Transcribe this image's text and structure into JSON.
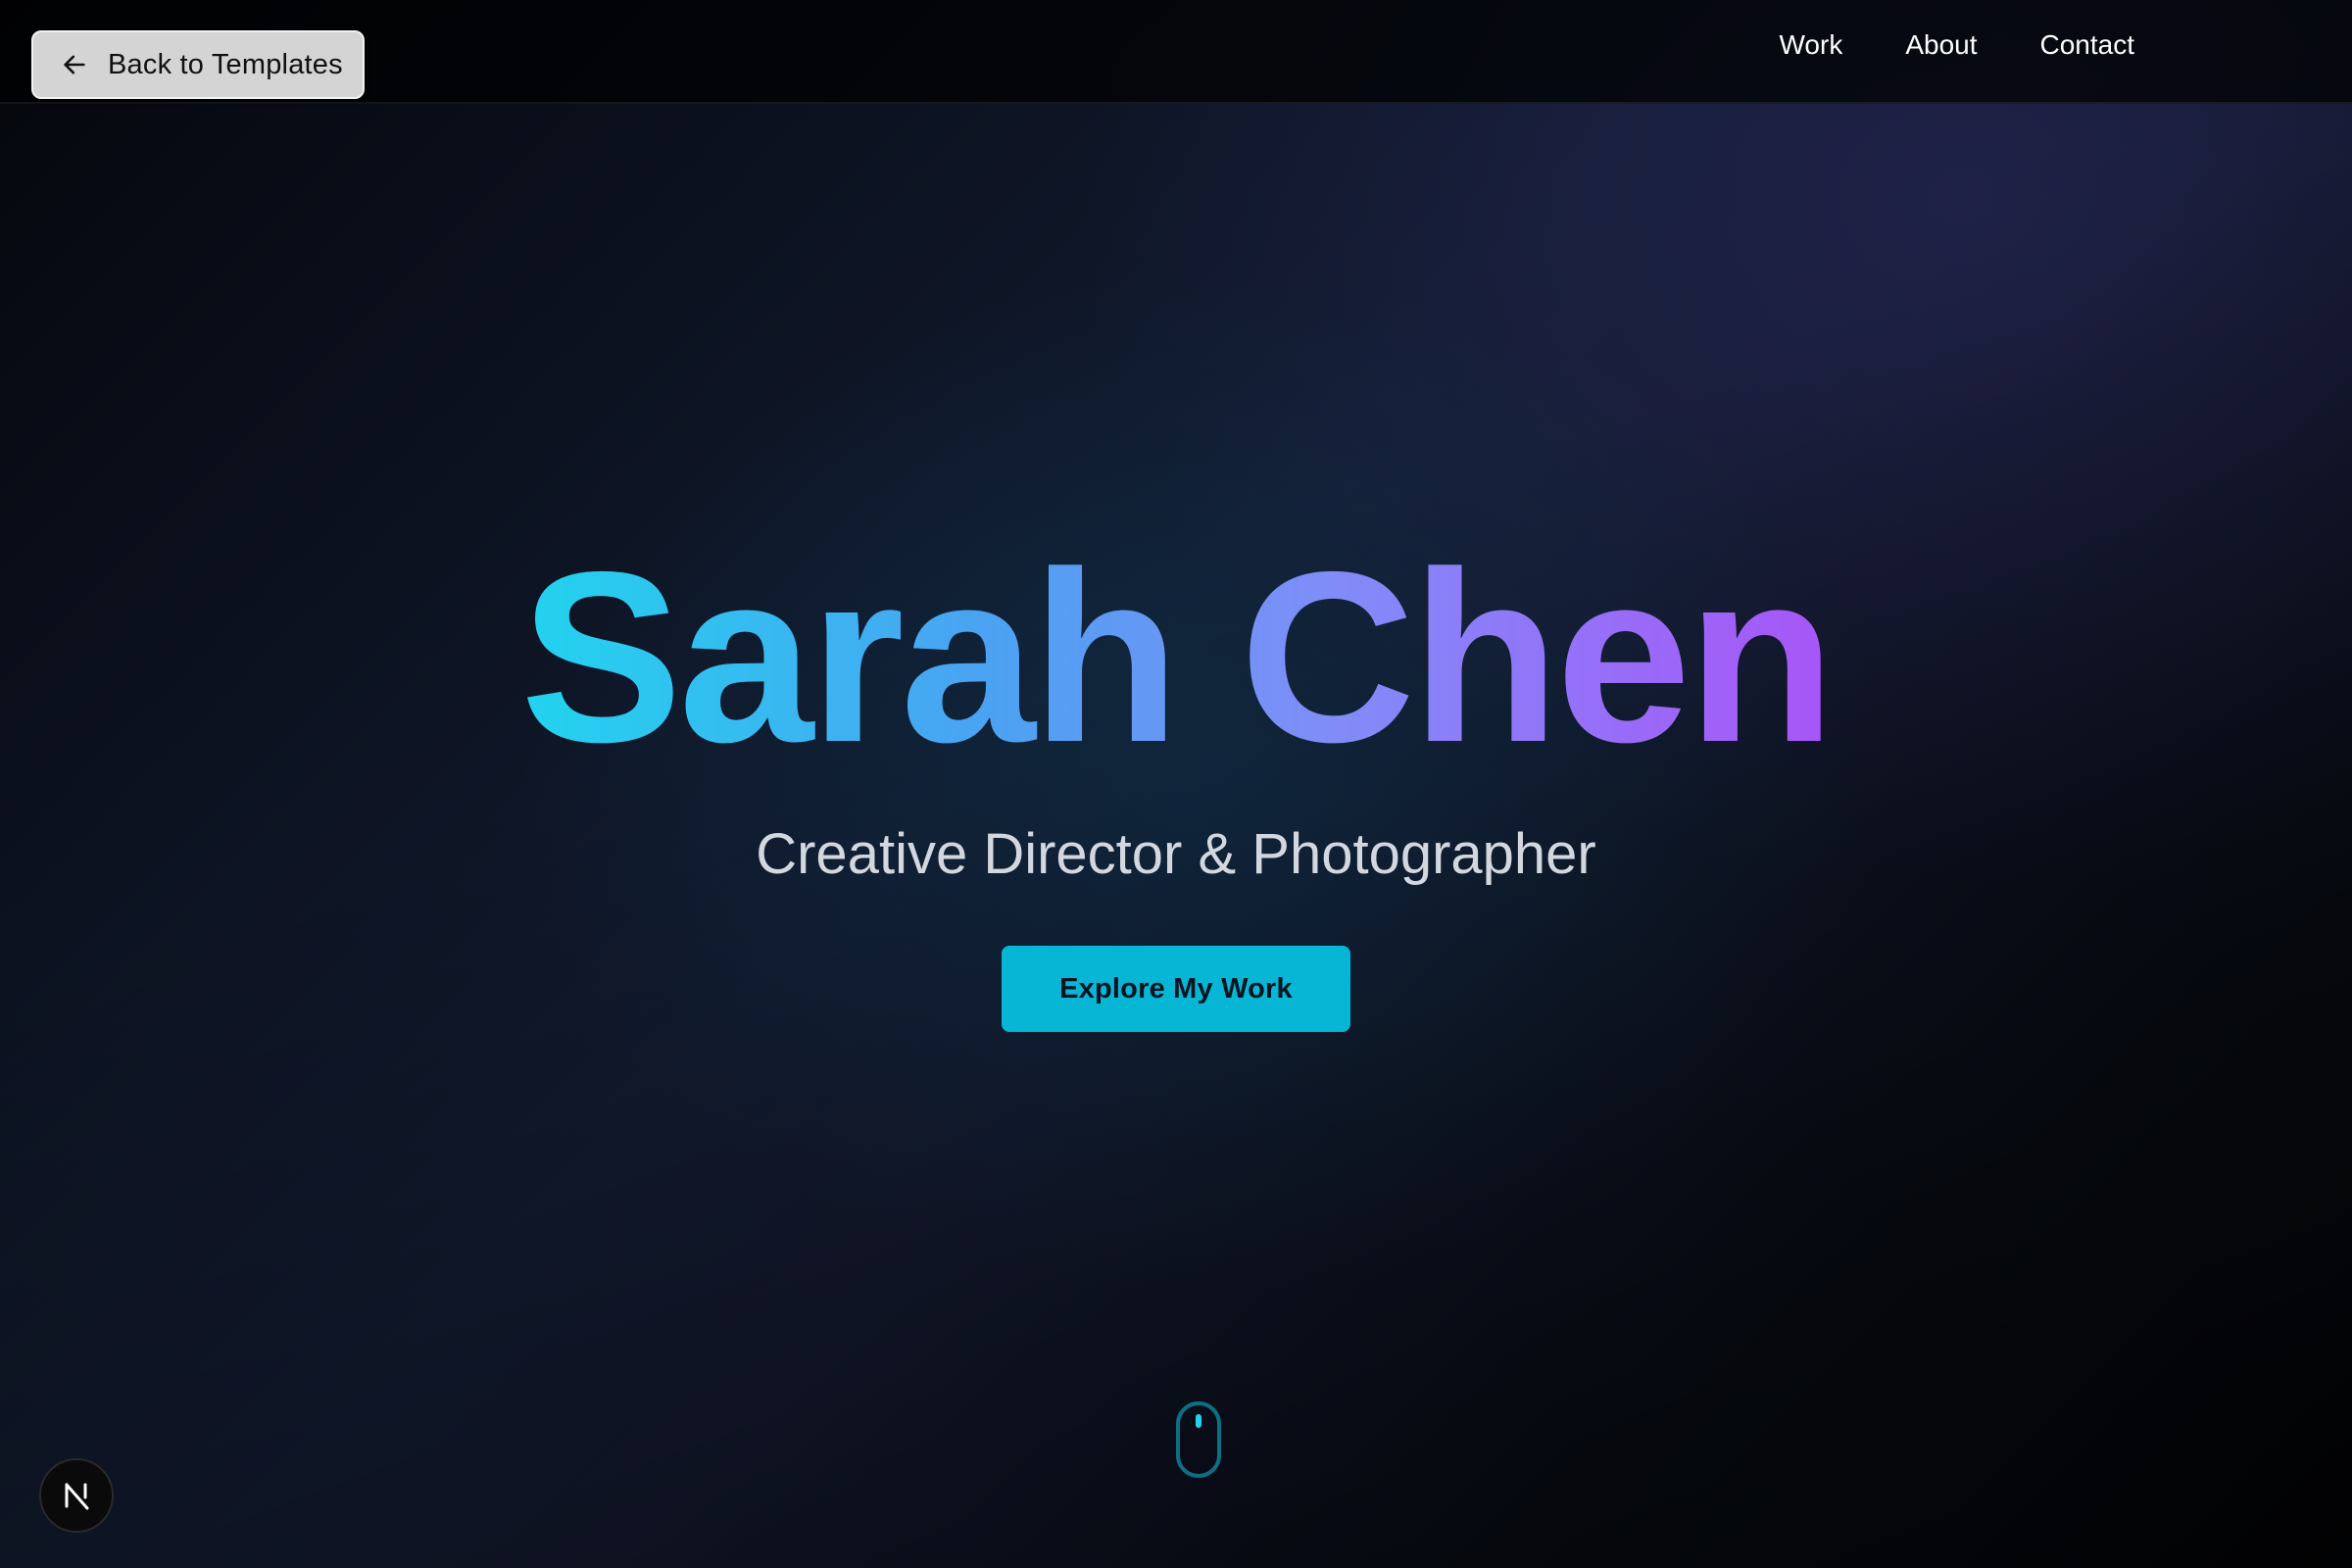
{
  "topbar": {
    "back_label": "Back to Templates",
    "back_icon": "arrow-left-icon",
    "nav": [
      {
        "label": "Work"
      },
      {
        "label": "About"
      },
      {
        "label": "Contact"
      }
    ]
  },
  "hero": {
    "name": "Sarah Chen",
    "subtitle": "Creative Director & Photographer",
    "cta_label": "Explore My Work"
  },
  "scroll_indicator": {
    "icon": "mouse-scroll-icon"
  },
  "badge": {
    "icon": "nextjs-icon",
    "letter": "N"
  },
  "colors": {
    "gradient_start": "#22d3ee",
    "gradient_mid": "#818cf8",
    "gradient_end": "#a855f7",
    "cta_background": "#06b6d4",
    "back_button_background": "#d4d4d4"
  }
}
